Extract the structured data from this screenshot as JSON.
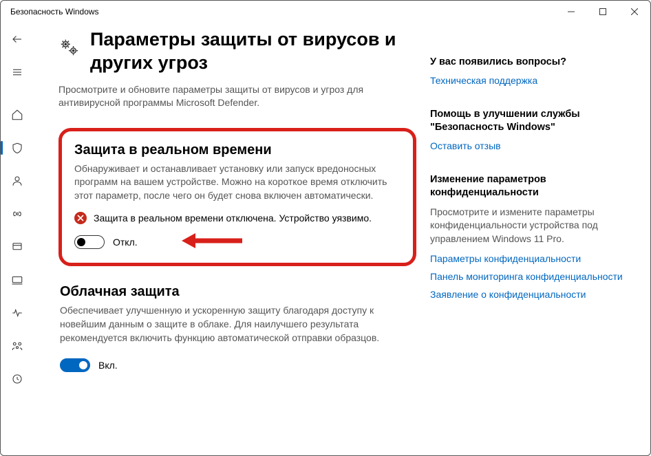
{
  "window": {
    "title": "Безопасность Windows"
  },
  "header": {
    "title": "Параметры защиты от вирусов и других угроз",
    "description": "Просмотрите и обновите параметры защиты от вирусов и угроз для антивирусной программы Microsoft Defender."
  },
  "realtime": {
    "title": "Защита в реальном времени",
    "description": "Обнаруживает и останавливает установку или запуск вредоносных программ на вашем устройстве. Можно на короткое время отключить этот параметр, после чего он будет снова включен автоматически.",
    "warning": "Защита в реальном времени отключена. Устройство уязвимо.",
    "toggle_label": "Откл."
  },
  "cloud": {
    "title": "Облачная защита",
    "description": "Обеспечивает улучшенную и ускоренную защиту благодаря доступу к новейшим данным о защите в облаке. Для наилучшего результата рекомендуется включить функцию автоматической отправки образцов.",
    "toggle_label": "Вкл."
  },
  "side": {
    "questions": {
      "heading": "У вас появились вопросы?",
      "link": "Техническая поддержка"
    },
    "feedback": {
      "heading": "Помощь в улучшении службы \"Безопасность Windows\"",
      "link": "Оставить отзыв"
    },
    "privacy": {
      "heading": "Изменение параметров конфиденциальности",
      "text": "Просмотрите и измените параметры конфиденциальности устройства под управлением Windows 11 Pro.",
      "link1": "Параметры конфиденциальности",
      "link2": "Панель мониторинга конфиденциальности",
      "link3": "Заявление о конфиденциальности"
    }
  }
}
